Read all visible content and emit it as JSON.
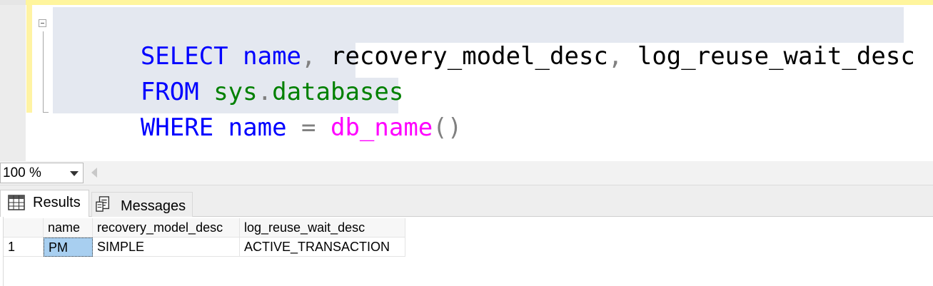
{
  "editor": {
    "lines": [
      {
        "tokens": [
          {
            "text": "SELECT",
            "kind": "keyword"
          },
          {
            "text": " name",
            "kind": "keyword"
          },
          {
            "text": ",",
            "kind": "punct"
          },
          {
            "text": " recovery_model_desc",
            "kind": "text"
          },
          {
            "text": ",",
            "kind": "punct"
          },
          {
            "text": " log_reuse_wait_desc",
            "kind": "text"
          }
        ]
      },
      {
        "tokens": [
          {
            "text": "FROM",
            "kind": "keyword"
          },
          {
            "text": " sys",
            "kind": "object"
          },
          {
            "text": ".",
            "kind": "punct"
          },
          {
            "text": "databases",
            "kind": "object"
          }
        ]
      },
      {
        "tokens": [
          {
            "text": "WHERE",
            "kind": "keyword"
          },
          {
            "text": " name",
            "kind": "keyword"
          },
          {
            "text": " =",
            "kind": "punct"
          },
          {
            "text": " db_name",
            "kind": "function"
          },
          {
            "text": "()",
            "kind": "punct"
          }
        ]
      }
    ],
    "colors": {
      "keyword": "#0000ff",
      "object": "#008000",
      "function": "#ff00ff",
      "punct": "#808080",
      "text": "#000000",
      "selection": "#e4e8f0"
    }
  },
  "zoom": {
    "value": "100 %"
  },
  "tabs": [
    {
      "label": "Results",
      "icon": "grid-icon",
      "active": true
    },
    {
      "label": "Messages",
      "icon": "messages-icon",
      "active": false
    }
  ],
  "results": {
    "columns": [
      "",
      "name",
      "recovery_model_desc",
      "log_reuse_wait_desc"
    ],
    "rows": [
      [
        "1",
        "PM",
        "SIMPLE",
        "ACTIVE_TRANSACTION"
      ]
    ],
    "selection_color": "#a8cff0"
  }
}
